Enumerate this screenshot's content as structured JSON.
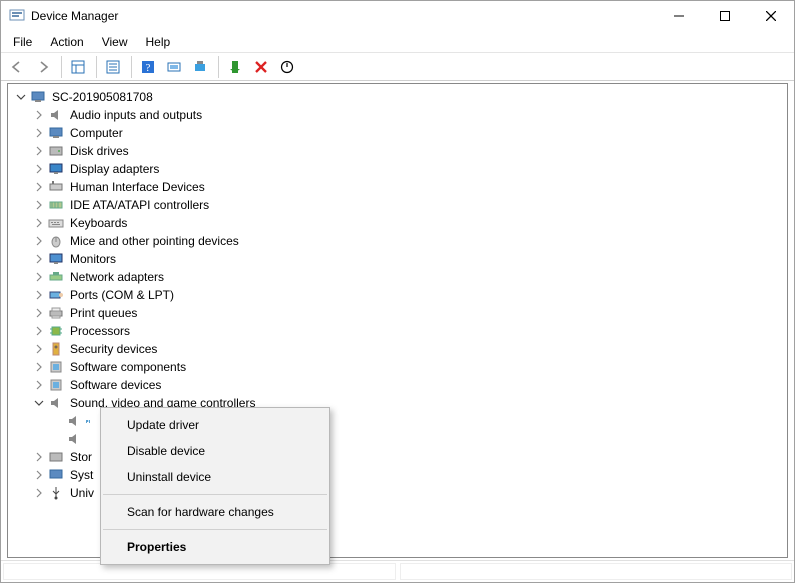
{
  "window": {
    "title": "Device Manager"
  },
  "menu": {
    "file": "File",
    "action": "Action",
    "view": "View",
    "help": "Help"
  },
  "tree": {
    "root": "SC-201905081708",
    "items": [
      "Audio inputs and outputs",
      "Computer",
      "Disk drives",
      "Display adapters",
      "Human Interface Devices",
      "IDE ATA/ATAPI controllers",
      "Keyboards",
      "Mice and other pointing devices",
      "Monitors",
      "Network adapters",
      "Ports (COM & LPT)",
      "Print queues",
      "Processors",
      "Security devices",
      "Software components",
      "Software devices",
      "Sound, video and game controllers"
    ],
    "sound_children": {
      "selected": "",
      "second": ""
    },
    "remaining": [
      "Stor",
      "Syst",
      "Univ"
    ]
  },
  "context_menu": {
    "update": "Update driver",
    "disable": "Disable device",
    "uninstall": "Uninstall device",
    "scan": "Scan for hardware changes",
    "properties": "Properties"
  }
}
